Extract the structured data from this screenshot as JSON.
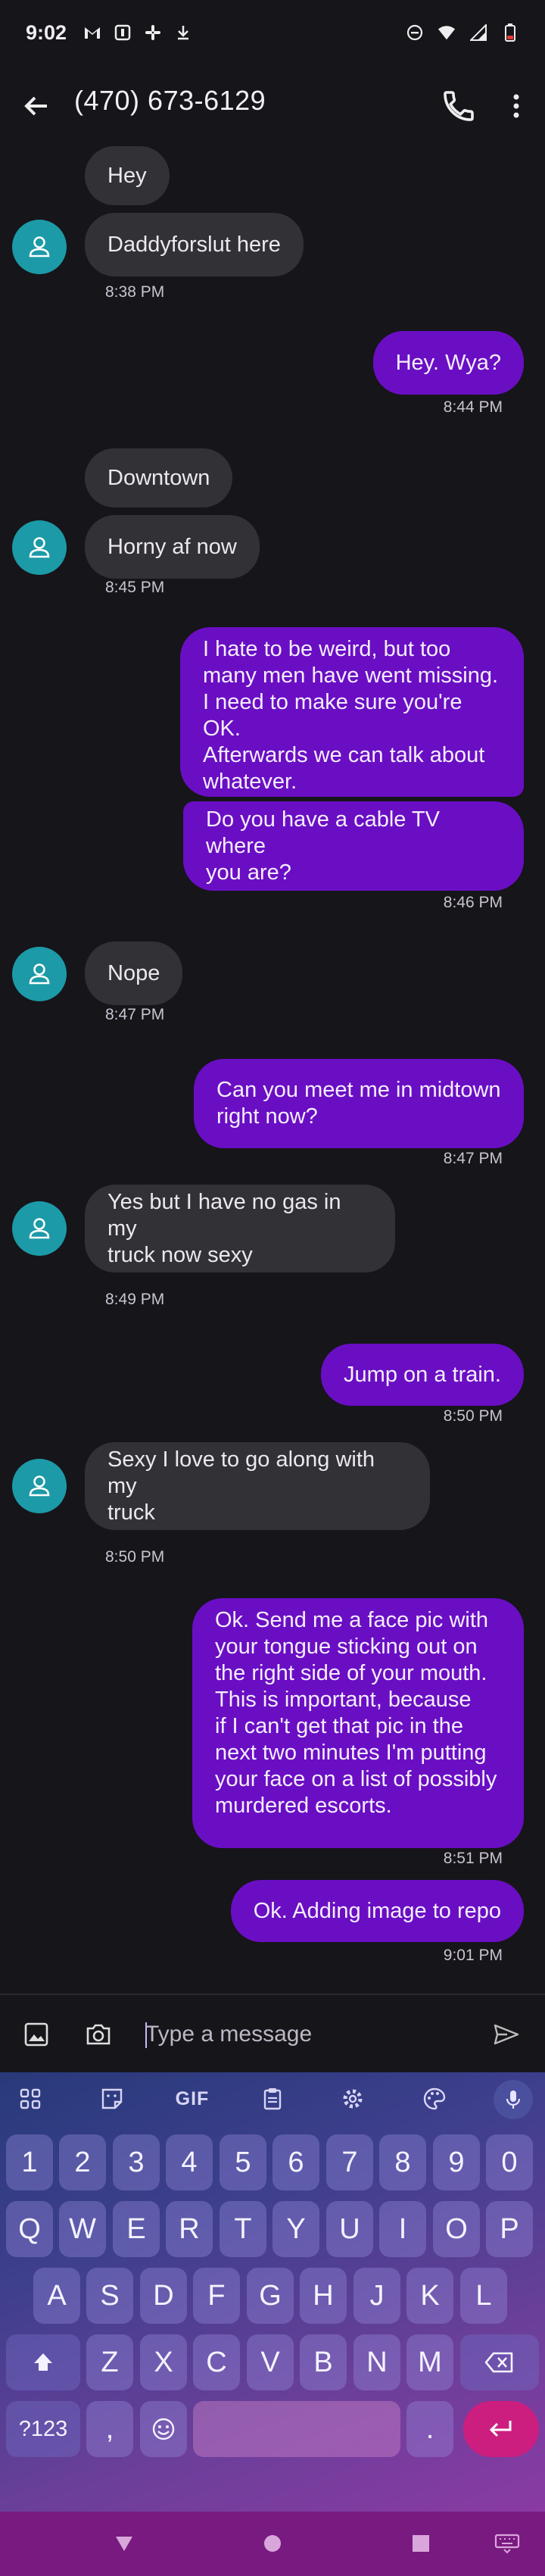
{
  "status_bar": {
    "time": "9:02",
    "left_icons": [
      "gmail-icon",
      "app-icon",
      "slack-icon",
      "download-icon"
    ],
    "right_icons": [
      "dnd-icon",
      "wifi-icon",
      "signal-icon",
      "battery-low-icon"
    ]
  },
  "app_bar": {
    "title": "(470) 673-6129",
    "icons": [
      "back-arrow-icon",
      "phone-icon",
      "more-vert-icon"
    ]
  },
  "messages": [
    {
      "dir": "in",
      "text": "Hey"
    },
    {
      "dir": "in",
      "text": "Daddyforslut here",
      "time": "8:38 PM"
    },
    {
      "dir": "out",
      "text": "Hey. Wya?",
      "time": "8:44 PM"
    },
    {
      "dir": "in",
      "text": "Downtown"
    },
    {
      "dir": "in",
      "text": "Horny af now",
      "time": "8:45 PM"
    },
    {
      "dir": "out",
      "lines": [
        "I hate to be weird, but too",
        "many men have went missing.",
        "I need to make sure you're OK.",
        "Afterwards we can talk about",
        "whatever."
      ]
    },
    {
      "dir": "out",
      "lines": [
        "Do you have a cable TV where",
        "you are?"
      ],
      "time": "8:46 PM"
    },
    {
      "dir": "in",
      "text": "Nope",
      "time": "8:47 PM"
    },
    {
      "dir": "out",
      "lines": [
        "Can you meet me in midtown",
        "right now?"
      ],
      "time": "8:47 PM"
    },
    {
      "dir": "in",
      "lines": [
        "Yes but I have no gas in my",
        "truck now sexy"
      ],
      "time": "8:49 PM"
    },
    {
      "dir": "out",
      "text": "Jump on a train.",
      "time": "8:50 PM"
    },
    {
      "dir": "in",
      "lines": [
        "Sexy I love to go along with my",
        "truck"
      ],
      "time": "8:50 PM"
    },
    {
      "dir": "out",
      "lines": [
        "Ok. Send me a face pic with",
        "your tongue sticking out on",
        "the right side of your mouth.",
        "This is important, because",
        "if I can't get that pic in the",
        "next two minutes I'm putting",
        "your face on a list of possibly",
        "murdered escorts."
      ],
      "time": "8:51 PM"
    },
    {
      "dir": "out",
      "text": "Ok. Adding image to repo",
      "time": "9:01 PM"
    }
  ],
  "compose": {
    "placeholder": "Type a message",
    "icons": [
      "gallery-icon",
      "camera-icon",
      "send-icon"
    ]
  },
  "keyboard": {
    "toolbar": {
      "gif_label": "GIF",
      "icons": [
        "apps-grid-icon",
        "sticker-icon",
        "clipboard-icon",
        "settings-icon",
        "palette-icon",
        "mic-icon"
      ]
    },
    "row_numbers": [
      "1",
      "2",
      "3",
      "4",
      "5",
      "6",
      "7",
      "8",
      "9",
      "0"
    ],
    "row1": [
      "Q",
      "W",
      "E",
      "R",
      "T",
      "Y",
      "U",
      "I",
      "O",
      "P"
    ],
    "row2": [
      "A",
      "S",
      "D",
      "F",
      "G",
      "H",
      "J",
      "K",
      "L"
    ],
    "row3": [
      "Z",
      "X",
      "C",
      "V",
      "B",
      "N",
      "M"
    ],
    "symbols_label": "?123",
    "comma": ",",
    "period": "."
  },
  "nav_bar": {
    "icons": [
      "back-triangle-icon",
      "home-circle-icon",
      "recents-square-icon",
      "keyboard-switch-icon"
    ]
  },
  "colors": {
    "background": "#16151a",
    "incoming": "#323136",
    "outgoing": "#6a0ec4",
    "avatar": "#1c9aa7",
    "navbar": "#791a80",
    "enter": "#cc1e7f"
  }
}
